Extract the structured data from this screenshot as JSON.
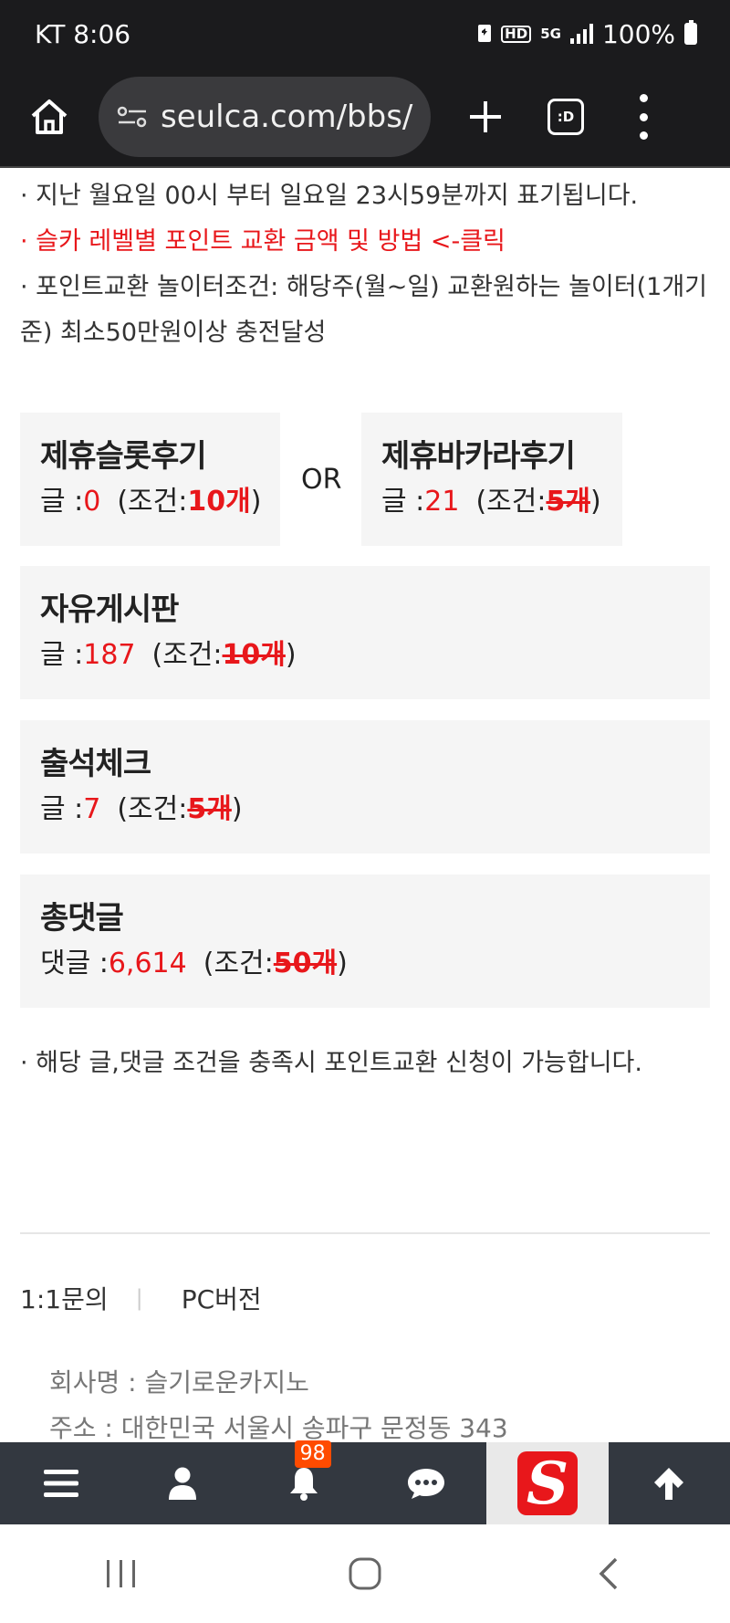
{
  "status_bar": {
    "carrier_time": "KT 8:06",
    "hd_label": "HD",
    "network_label": "5G",
    "battery": "100%"
  },
  "browser": {
    "url": "seulca.com/bbs/",
    "tabs_label": ":D"
  },
  "notes": {
    "line1": "· 지난 월요일 00시 부터 일요일 23시59분까지 표기됩니다.",
    "line2": "· 슬카 레벨별 포인트 교환 금액 및 방법 <-클릭",
    "line3": "· 포인트교환 놀이터조건: 해당주(월~일) 교환원하는 놀이터(1개기준) 최소50만원이상 충전달성"
  },
  "cards": {
    "slot": {
      "title": "제휴슬롯후기",
      "count_label": "글 :",
      "count": "0",
      "cond_label": "(조건:",
      "cond_value": "10개",
      "cond_close": ")"
    },
    "or_label": "OR",
    "baccarat": {
      "title": "제휴바카라후기",
      "count_label": "글 :",
      "count": "21",
      "cond_label": "(조건:",
      "cond_value": "5개",
      "cond_close": ")"
    },
    "free": {
      "title": "자유게시판",
      "count_label": "글 :",
      "count": "187",
      "cond_label": "(조건:",
      "cond_value": "10개",
      "cond_close": ")"
    },
    "attendance": {
      "title": "출석체크",
      "count_label": "글 :",
      "count": "7",
      "cond_label": "(조건:",
      "cond_value": "5개",
      "cond_close": ")"
    },
    "comments": {
      "title": "총댓글",
      "count_label": "댓글 :",
      "count": "6,614",
      "cond_label": "(조건:",
      "cond_value": "50개",
      "cond_close": ")"
    }
  },
  "bottom_note": "· 해당 글,댓글 조건을 충족시 포인트교환 신청이 가능합니다.",
  "footer": {
    "inquiry": "1:1문의",
    "separator": "|",
    "pc_version": "PC버전",
    "company_name": "회사명 : 슬기로운카지노",
    "address": "주소 : 대한민국 서울시 송파구 문정동 343"
  },
  "app_nav": {
    "notification_count": "98",
    "logo_letter": "S"
  },
  "colors": {
    "accent_red": "#e8171b",
    "nav_bg": "#333840",
    "badge_orange": "#ff4b00"
  }
}
